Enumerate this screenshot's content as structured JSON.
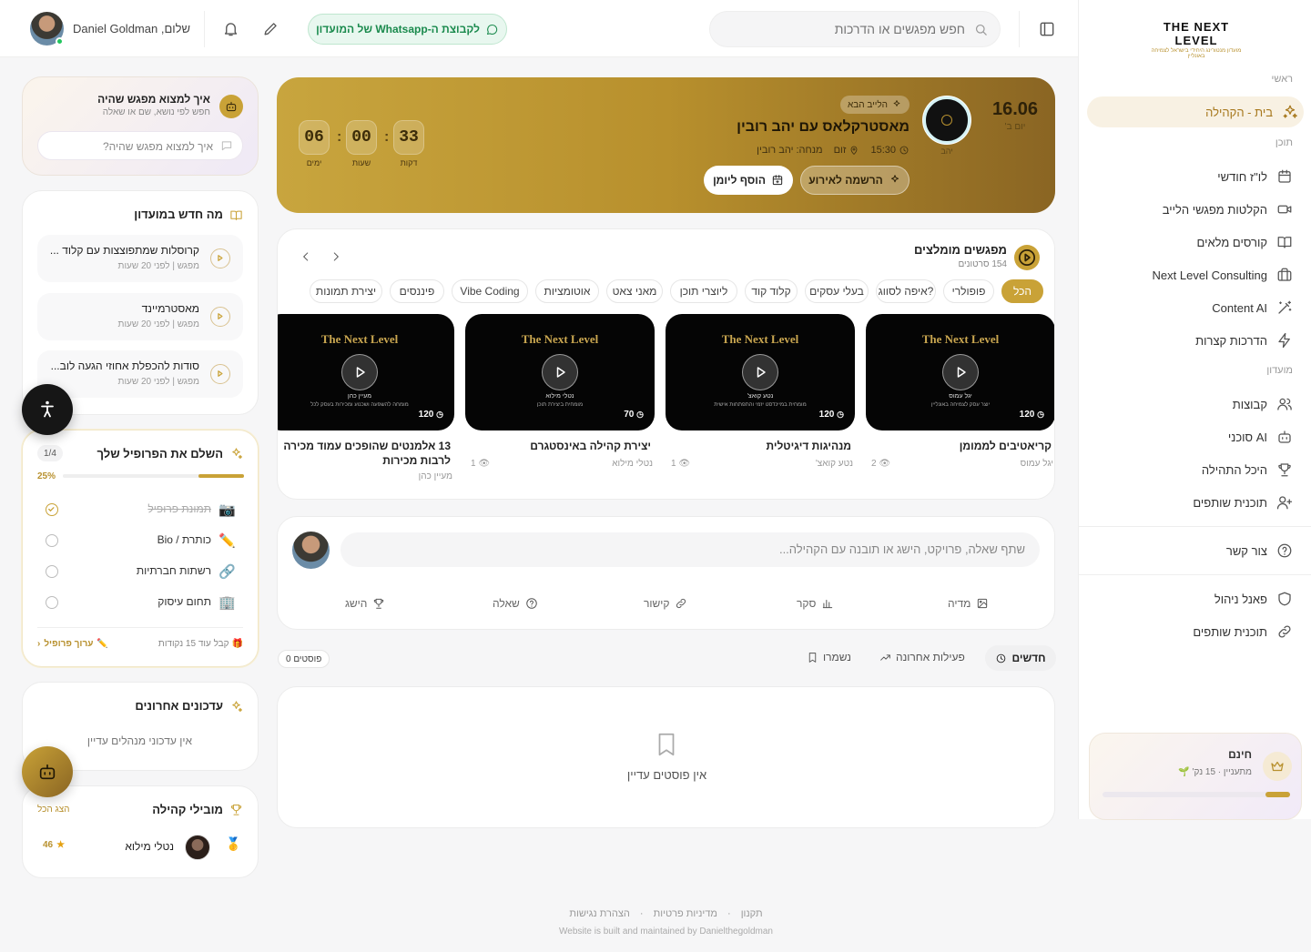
{
  "sidebar": {
    "logo_title": "THE NEXT LEVEL",
    "logo_sub": "מועדון מנטורינג היחידי בישראל לצמיחה באונליין",
    "section_main": "ראשי",
    "section_content": "תוכן",
    "section_club": "מועדון",
    "items": [
      {
        "label": "בית - הקהילה",
        "icon": "sparkles-icon",
        "active": true
      },
      {
        "label": "לו\"ז חודשי",
        "icon": "calendar-icon"
      },
      {
        "label": "הקלטות מפגשי הלייב",
        "icon": "video-icon"
      },
      {
        "label": "קורסים מלאים",
        "icon": "book-icon"
      },
      {
        "label": "Next Level Consulting",
        "icon": "briefcase-icon"
      },
      {
        "label": "Content AI",
        "icon": "wand-icon"
      },
      {
        "label": "הדרכות קצרות",
        "icon": "bolt-icon"
      },
      {
        "label": "קבוצות",
        "icon": "users-icon"
      },
      {
        "label": "סוכני AI",
        "icon": "bot-icon"
      },
      {
        "label": "היכל התהילה",
        "icon": "trophy-icon"
      },
      {
        "label": "תוכנית שותפים",
        "icon": "user-plus-icon"
      },
      {
        "label": "צור קשר",
        "icon": "help-icon"
      },
      {
        "label": "פאנל ניהול",
        "icon": "shield-icon"
      },
      {
        "label": "תוכנית שותפים",
        "icon": "link-icon"
      }
    ],
    "plan": {
      "name": "חינם",
      "level": "מתעניין · 15 נק'",
      "progress": 0.13
    }
  },
  "topbar": {
    "user_name": "Daniel Goldman ,שלום",
    "whatsapp": "לקבוצת ה-Whatsapp של המועדון",
    "search_placeholder": "חפש מפגשים או הדרכות"
  },
  "hero": {
    "badge": "הלייב הבא",
    "title": "מאסטרקלאס עם יהב רובין",
    "time": "15:30",
    "platform": "זום",
    "host": "מנחה: יהב רובין",
    "date": "16.06",
    "weekday": "יום ב'",
    "avatar_name": "יהב",
    "register": "הרשמה לאירוע",
    "calendar": "הוסף ליומן",
    "countdown": [
      {
        "v": "33",
        "l": "דקות"
      },
      {
        "v": "00",
        "l": "שעות"
      },
      {
        "v": "06",
        "l": "ימים"
      }
    ]
  },
  "recommended": {
    "title": "מפגשים מומלצים",
    "count": "154 סרטונים",
    "chips": [
      "הכל",
      "פופולרי",
      "איפה לסווג?",
      "בעלי עסקים",
      "קלוד קוד",
      "ליוצרי תוכן",
      "מאני צאט",
      "אוטומציות",
      "Vibe Coding",
      "פיננסים",
      "יצירת תמונות"
    ],
    "videos": [
      {
        "brand": "The Next Level",
        "host": "יגל עמוס",
        "sub": "יוצר עסק לצמיחה באונליין",
        "dur": "120",
        "title": "קריאטיבים לממומן",
        "views": "2",
        "author": "יגל עמוס"
      },
      {
        "brand": "The Next Level",
        "host": "נטע קואצ'",
        "sub": "מומחית במיינדסט יזמי והתפתחות אישית",
        "dur": "120",
        "title": "מנהיגות דיגיטלית",
        "views": "1",
        "author": "נטע קואצ'"
      },
      {
        "brand": "The Next Level",
        "host": "נטלי מילוא",
        "sub": "מומחית ביצירת תוכן",
        "dur": "70",
        "title": "יצירת קהילה באינסטגרם",
        "views": "1",
        "author": "נטלי מילוא"
      },
      {
        "brand": "The Next Level",
        "host": "מעיין כהן",
        "sub": "מומחה להשפעה ושכנוע ומכירות בעסק לכל",
        "dur": "120",
        "title": "13 אלמנטים שהופכים עמוד מכירה לרבות מכירות",
        "views": "",
        "author": "מעיין כהן"
      }
    ]
  },
  "composer": {
    "placeholder": "שתף שאלה, פרויקט, הישג או תובנה עם הקהילה...",
    "actions": [
      {
        "label": "מדיה",
        "icon": "image-icon"
      },
      {
        "label": "סקר",
        "icon": "poll-icon"
      },
      {
        "label": "קישור",
        "icon": "link-icon"
      },
      {
        "label": "שאלה",
        "icon": "question-icon"
      },
      {
        "label": "הישג",
        "icon": "trophy-icon"
      }
    ]
  },
  "feed": {
    "tabs": [
      "חדשים",
      "פעילות אחרונה",
      "נשמרו"
    ],
    "count": "0 פוסטים",
    "empty": "אין פוסטים עדיין"
  },
  "find": {
    "title": "איך למצוא מפגש שהיה",
    "sub": "חפש לפי נושא, שם או שאלה",
    "placeholder": "איך למצוא מפגש שהיה?"
  },
  "news": {
    "title": "מה חדש במועדון",
    "items": [
      {
        "title": "קרוסלות שמתפוצצות עם קלוד ...",
        "meta": "מפגש | לפני 20 שעות"
      },
      {
        "title": "מאסטרמיינד",
        "meta": "מפגש | לפני 20 שעות"
      },
      {
        "title": "סודות להכפלת אחוזי הגעה לוב...",
        "meta": "מפגש | לפני 20 שעות"
      }
    ]
  },
  "profile": {
    "title": "השלם את הפרופיל שלך",
    "step": "1/4",
    "pct": "25%",
    "progress": 0.25,
    "tasks": [
      {
        "label": "תמונת פרופיל",
        "emoji": "📷",
        "done": true
      },
      {
        "label": "כותרת / Bio",
        "emoji": "✏️",
        "done": false
      },
      {
        "label": "רשתות חברתיות",
        "emoji": "🔗",
        "done": false
      },
      {
        "label": "תחום עיסוק",
        "emoji": "🏢",
        "done": false
      }
    ],
    "reward": "קבל עוד 15 נקודות",
    "edit": "ערוך פרופיל"
  },
  "updates": {
    "title": "עדכונים אחרונים",
    "empty": "אין עדכוני מנהלים עדיין"
  },
  "leaders": {
    "title": "מובילי קהילה",
    "show_all": "הצג הכל",
    "rows": [
      {
        "rank": "🥇",
        "name": "נטלי מילוא",
        "points": "46"
      }
    ]
  },
  "footer": {
    "links": [
      "תקנון",
      "מדיניות פרטיות",
      "הצהרת נגישות"
    ],
    "credit": "Website is built and maintained by Danielthegoldman"
  },
  "colors": {
    "gold": "#c9a237",
    "gold_dark": "#8a6523",
    "whatsapp": "#1a8a4d"
  }
}
